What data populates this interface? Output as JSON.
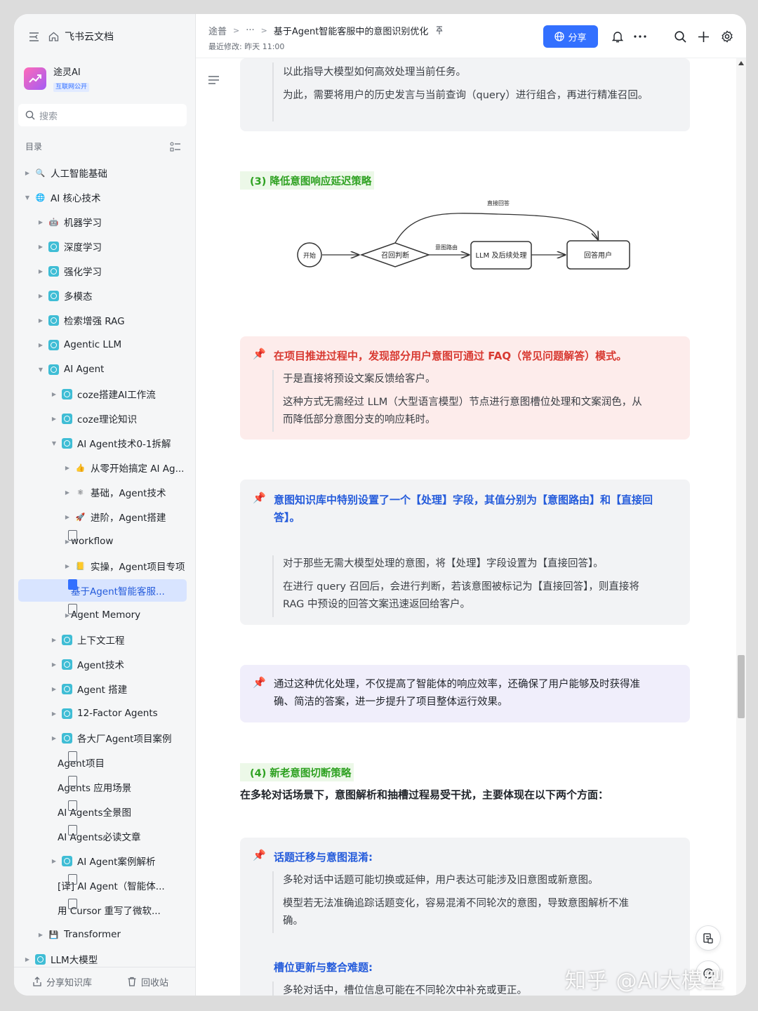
{
  "sidebar": {
    "app_name": "飞书云文档",
    "workspace": {
      "name": "途灵AI",
      "badge": "互联网公开"
    },
    "search_placeholder": "搜索",
    "toc_label": "目录",
    "tree": [
      {
        "label": "人工智能基础",
        "level": 0,
        "expander": "collapsed",
        "icon": "magnifier-icon"
      },
      {
        "label": "AI 核心技术",
        "level": 0,
        "expander": "expanded",
        "icon": "globe-icon"
      },
      {
        "label": "机器学习",
        "level": 1,
        "expander": "collapsed",
        "icon": "robot-icon"
      },
      {
        "label": "深度学习",
        "level": 1,
        "expander": "collapsed",
        "icon": "wiki-node-icon"
      },
      {
        "label": "强化学习",
        "level": 1,
        "expander": "collapsed",
        "icon": "wiki-node-icon"
      },
      {
        "label": "多模态",
        "level": 1,
        "expander": "collapsed",
        "icon": "wiki-node-icon"
      },
      {
        "label": "检索增强 RAG",
        "level": 1,
        "expander": "collapsed",
        "icon": "wiki-node-icon"
      },
      {
        "label": "Agentic LLM",
        "level": 1,
        "expander": "collapsed",
        "icon": "wiki-node-icon"
      },
      {
        "label": "AI Agent",
        "level": 1,
        "expander": "expanded",
        "icon": "wiki-node-icon"
      },
      {
        "label": "coze搭建AI工作流",
        "level": 2,
        "expander": "collapsed",
        "icon": "wiki-node-icon"
      },
      {
        "label": "coze理论知识",
        "level": 2,
        "expander": "collapsed",
        "icon": "wiki-node-icon"
      },
      {
        "label": "AI Agent技术0-1拆解",
        "level": 2,
        "expander": "expanded",
        "icon": "wiki-node-icon"
      },
      {
        "label": "从零开始搞定 AI Ag...",
        "level": 3,
        "expander": "collapsed",
        "icon": "thumbs-up-icon"
      },
      {
        "label": "基础，Agent技术",
        "level": 3,
        "expander": "collapsed",
        "icon": "molecule-icon"
      },
      {
        "label": "进阶，Agent搭建",
        "level": 3,
        "expander": "collapsed",
        "icon": "rocket-icon"
      },
      {
        "label": "workflow",
        "level": 3,
        "expander": "collapsed",
        "icon": "doc-icon"
      },
      {
        "label": "实操，Agent项目专项",
        "level": 3,
        "expander": "collapsed",
        "icon": "folder-icon"
      },
      {
        "label": "基于Agent智能客服...",
        "level": 3,
        "expander": "none",
        "icon": "doc-icon",
        "active": true
      },
      {
        "label": "Agent Memory",
        "level": 3,
        "expander": "collapsed",
        "icon": "doc-icon"
      },
      {
        "label": "上下文工程",
        "level": 2,
        "expander": "collapsed",
        "icon": "wiki-node-icon"
      },
      {
        "label": "Agent技术",
        "level": 2,
        "expander": "collapsed",
        "icon": "wiki-node-icon"
      },
      {
        "label": "Agent 搭建",
        "level": 2,
        "expander": "collapsed",
        "icon": "wiki-node-icon"
      },
      {
        "label": "12-Factor Agents",
        "level": 2,
        "expander": "collapsed",
        "icon": "wiki-node-icon"
      },
      {
        "label": "各大厂Agent项目案例",
        "level": 2,
        "expander": "collapsed",
        "icon": "wiki-node-icon"
      },
      {
        "label": "Agent项目",
        "level": 2,
        "expander": "none",
        "icon": "table-doc-icon"
      },
      {
        "label": "Agents 应用场景",
        "level": 2,
        "expander": "none",
        "icon": "table-doc-icon"
      },
      {
        "label": "AI Agents全景图",
        "level": 2,
        "expander": "none",
        "icon": "table-doc-icon"
      },
      {
        "label": "AI Agents必读文章",
        "level": 2,
        "expander": "none",
        "icon": "table-doc-icon"
      },
      {
        "label": "AI Agent案例解析",
        "level": 2,
        "expander": "collapsed",
        "icon": "wiki-node-icon"
      },
      {
        "label": "[译] AI Agent（智能体...",
        "level": 2,
        "expander": "none",
        "icon": "doc-icon"
      },
      {
        "label": "用 Cursor 重写了微软...",
        "level": 2,
        "expander": "none",
        "icon": "doc-icon"
      },
      {
        "label": "Transformer",
        "level": 1,
        "expander": "collapsed",
        "icon": "save-icon"
      },
      {
        "label": "LLM大模型",
        "level": 0,
        "expander": "collapsed",
        "icon": "wiki-node-icon"
      }
    ],
    "bottom": {
      "share": "分享知识库",
      "trash": "回收站"
    }
  },
  "header": {
    "breadcrumb": [
      "途普",
      "···",
      "基于Agent智能客服中的意图识别优化"
    ],
    "last_edit": "最近修改: 昨天 11:00",
    "share_label": "分享"
  },
  "doc": {
    "callout1": {
      "lines": [
        "以此指导大模型如何高效处理当前任务。",
        "为此，需要将用户的历史发言与当前查询（query）进行组合，再进行精准召回。"
      ]
    },
    "section3": "(3)  降低意图响应延迟策略",
    "diagram": {
      "nodes": {
        "start": "开始",
        "recall": "召回判断",
        "llm": "LLM 及后续处理",
        "answer": "回答用户"
      },
      "edges": {
        "direct": "直接回答",
        "route": "意图路由"
      }
    },
    "callout2": {
      "title": "在项目推进过程中，发现部分用户意图可通过 FAQ（常见问题解答）模式。",
      "lines": [
        "于是直接将预设文案反馈给客户。",
        "这种方式无需经过 LLM（大型语言模型）节点进行意图槽位处理和文案润色，从",
        "而降低部分意图分支的响应耗时。"
      ]
    },
    "callout3": {
      "title_l1": "意图知识库中特别设置了一个【处理】字段，其值分别为【意图路由】和【直接回",
      "title_l2": "答】。",
      "lines": [
        "对于那些无需大模型处理的意图，将【处理】字段设置为【直接回答】。",
        "在进行 query 召回后，会进行判断，若该意图被标记为【直接回答】，则直接将",
        "RAG 中预设的回答文案迅速返回给客户。"
      ]
    },
    "callout4": {
      "lines": [
        "通过这种优化处理，不仅提高了智能体的响应效率，还确保了用户能够及时获得准",
        "确、简洁的答案，进一步提升了项目整体运行效果。"
      ]
    },
    "section4": "(4)  新老意图切断策略",
    "section4_intro": "在多轮对话场景下，意图解析和抽槽过程易受干扰，主要体现在以下两个方面：",
    "callout5": {
      "title1": "话题迁移与意图混淆:",
      "lines1": [
        "多轮对话中话题可能切换或延伸，用户表达可能涉及旧意图或新意图。",
        "模型若无法准确追踪话题变化，容易混淆不同轮次的意图，导致意图解析不准",
        "确。"
      ],
      "title2": "槽位更新与整合难题:",
      "lines2": [
        "多轮对话中，槽位信息可能在不同轮次中补充或更正。"
      ]
    }
  },
  "watermark": "知乎 @AI大模型",
  "colors": {
    "accent": "#3370ff",
    "highlight_green": "#2ea121",
    "callout_red": "#d83931",
    "callout_blue": "#245bdb"
  }
}
